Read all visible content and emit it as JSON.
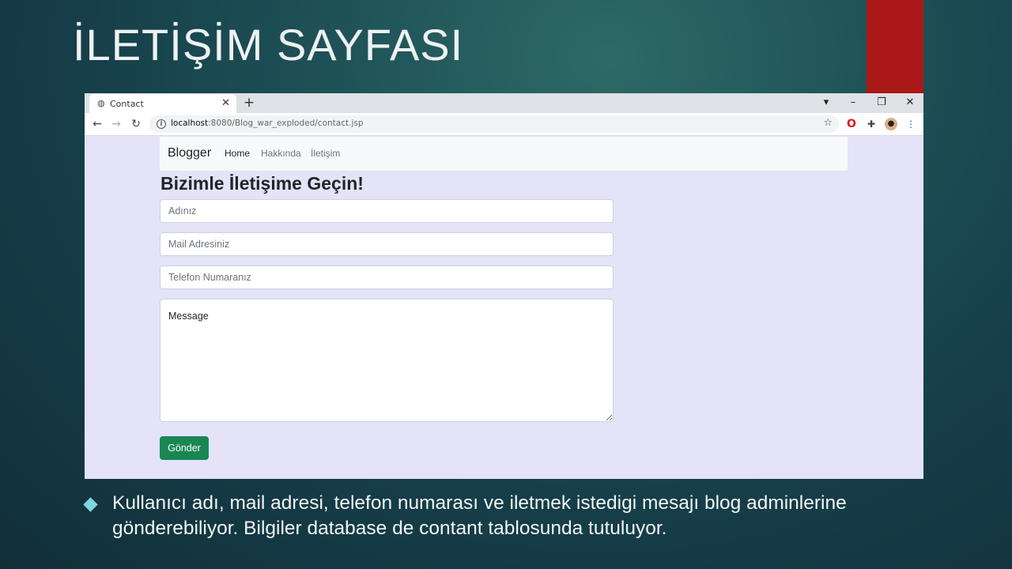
{
  "slide": {
    "title": "İLETİŞİM SAYFASI",
    "bullet": "Kullanıcı adı, mail adresi, telefon numarası ve iletmek istedigi mesajı blog adminlerine gönderebiliyor. Bilgiler database de contant tablosunda tutuluyor.",
    "accent_color": "#ab1818",
    "bullet_color": "#7fd6e0"
  },
  "browser": {
    "tab_title": "Contact",
    "tab_close": "✕",
    "new_tab": "+",
    "url_host": "localhost",
    "url_path": ":8080/Blog_war_exploded/contact.jsp",
    "window_controls": {
      "profile": "▾",
      "minimize": "–",
      "restore": "❐",
      "close": "✕"
    },
    "nav": {
      "back": "←",
      "forward": "→",
      "reload": "↻"
    },
    "icons": [
      "globe-icon",
      "info-icon",
      "star-icon",
      "opera-icon",
      "puzzle-icon",
      "avatar-icon",
      "kebab-menu-icon"
    ]
  },
  "site": {
    "brand": "Blogger",
    "nav": [
      {
        "label": "Home",
        "active": true
      },
      {
        "label": "Hakkında",
        "active": false
      },
      {
        "label": "İletişim",
        "active": false
      }
    ],
    "form": {
      "title": "Bizimle İletişime Geçin!",
      "name_placeholder": "Adınız",
      "email_placeholder": "Mail Adresiniz",
      "phone_placeholder": "Telefon Numaranız",
      "message_placeholder": "Message",
      "submit_label": "Gönder"
    },
    "colors": {
      "page_bg": "#e4e3f8",
      "navbar_bg": "#f8f9fa",
      "submit_bg": "#198754"
    }
  }
}
